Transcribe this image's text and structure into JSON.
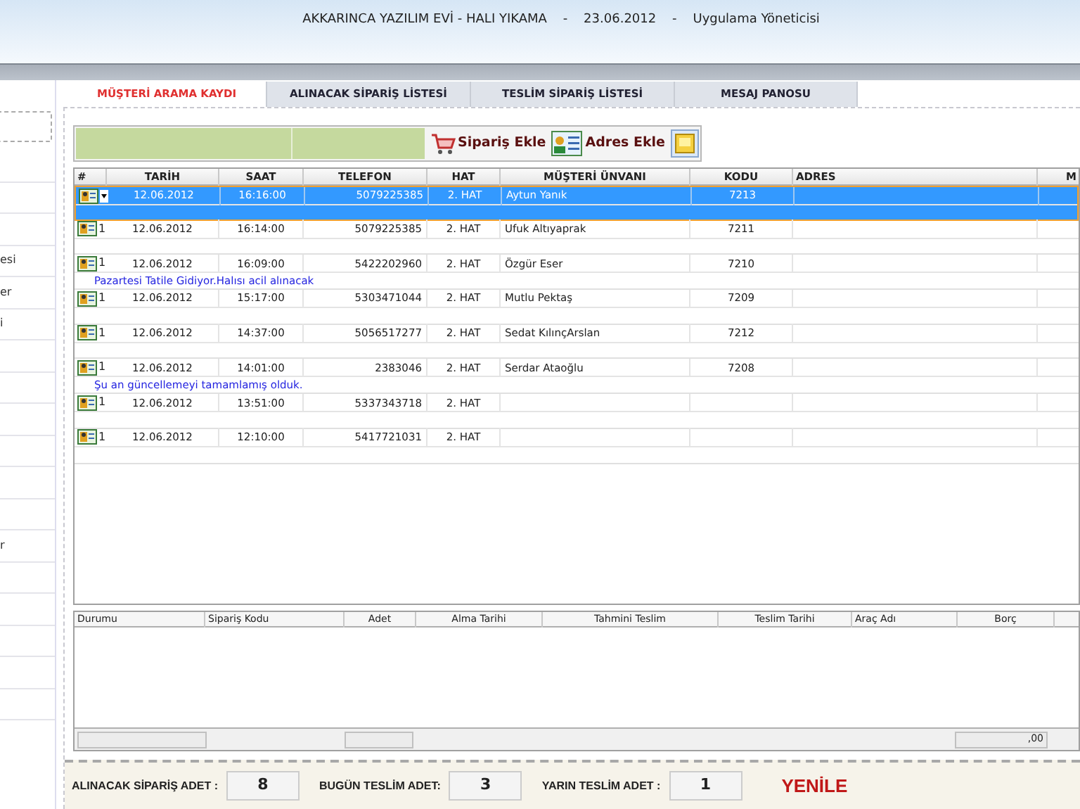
{
  "window": {
    "title": "AKKARINCA YAZILIM EVİ - HALI YIKAMA    -    23.06.2012    -    Uygulama Yöneticisi"
  },
  "sidebar": {
    "items": [
      {
        "label": "esi"
      },
      {
        "label": "er"
      },
      {
        "label": "i"
      },
      {
        "label": "r"
      }
    ]
  },
  "tabs": [
    {
      "label": "MÜŞTERİ ARAMA KAYDI",
      "selected": true
    },
    {
      "label": "ALINACAK SİPARİŞ LİSTESİ",
      "selected": false
    },
    {
      "label": "TESLİM SİPARİŞ LİSTESİ",
      "selected": false
    },
    {
      "label": "MESAJ PANOSU",
      "selected": false
    }
  ],
  "toolbar": {
    "buttons": [
      {
        "label": "Sipariş Ekle",
        "kind": "cart"
      },
      {
        "label": "Adres Ekle",
        "kind": "address"
      },
      {
        "kind": "note"
      }
    ]
  },
  "table": {
    "columns": [
      "#",
      "TARİH",
      "SAAT",
      "TELEFON",
      "HAT",
      "MÜŞTERİ ÜNVANI",
      "KODU",
      "ADRES",
      "M"
    ],
    "rows": [
      {
        "selected": true,
        "date": "12.06.2012",
        "time": "16:16:00",
        "phone": "5079225385",
        "line": "2. HAT",
        "customer": "Aytun Yanık",
        "code": "7213"
      },
      {
        "selected": false,
        "number": "1",
        "date": "12.06.2012",
        "time": "16:14:00",
        "phone": "5079225385",
        "line": "2. HAT",
        "customer": "Ufuk Altıyaprak",
        "code": "7211"
      },
      {
        "selected": false,
        "number": "1",
        "date": "12.06.2012",
        "time": "16:09:00",
        "phone": "5422202960",
        "line": "2. HAT",
        "customer": "Özgür Eser",
        "code": "7210",
        "note": "Pazartesi Tatile Gidiyor.Halısı acil alınacak"
      },
      {
        "selected": false,
        "number": "1",
        "date": "12.06.2012",
        "time": "15:17:00",
        "phone": "5303471044",
        "line": "2. HAT",
        "customer": "Mutlu Pektaş",
        "code": "7209"
      },
      {
        "selected": false,
        "number": "1",
        "date": "12.06.2012",
        "time": "14:37:00",
        "phone": "5056517277",
        "line": "2. HAT",
        "customer": "Sedat KılınçArslan",
        "code": "7212"
      },
      {
        "selected": false,
        "number": "1",
        "date": "12.06.2012",
        "time": "14:01:00",
        "phone": "2383046",
        "line": "2. HAT",
        "customer": "Serdar Ataoğlu",
        "code": "7208",
        "note": "Şu an güncellemeyi tamamlamış olduk."
      },
      {
        "selected": false,
        "number": "1",
        "date": "12.06.2012",
        "time": "13:51:00",
        "phone": "5337343718",
        "line": "2. HAT"
      },
      {
        "selected": false,
        "number": "1",
        "date": "12.06.2012",
        "time": "12:10:00",
        "phone": "5417721031",
        "line": "2. HAT"
      }
    ]
  },
  "orders": {
    "columns": [
      "Durumu",
      "Sipariş Kodu",
      "Adet",
      "Alma Tarihi",
      "Tahmini Teslim",
      "Teslim Tarihi",
      "Araç Adı",
      "Borç"
    ],
    "total": ",00"
  },
  "footer": {
    "counters": [
      {
        "label": "ALINACAK SİPARİŞ ADET :",
        "value": "8"
      },
      {
        "label": "BUGÜN TESLİM ADET:",
        "value": "3"
      },
      {
        "label": "YARIN TESLİM ADET :",
        "value": "1"
      }
    ],
    "refresh": "YENİLE"
  }
}
